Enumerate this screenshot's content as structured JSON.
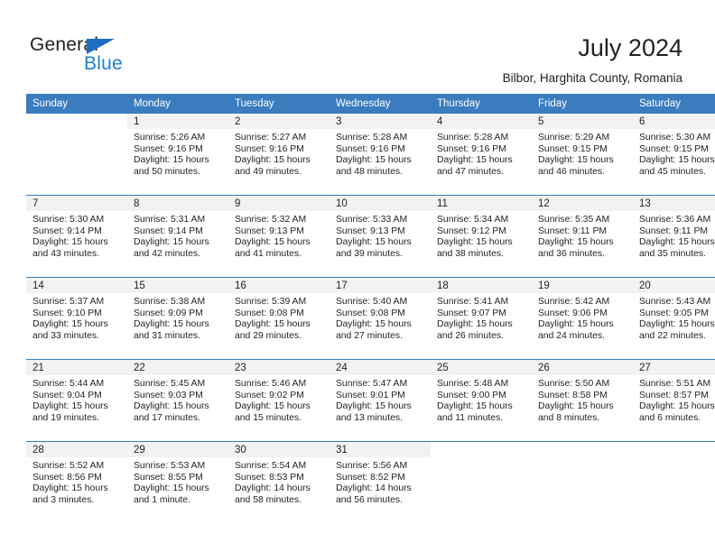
{
  "brand": {
    "name_part1": "General",
    "name_part2": "Blue"
  },
  "header": {
    "title": "July 2024",
    "location": "Bilbor, Harghita County, Romania"
  },
  "colors": {
    "header_blue": "#3a7cbe",
    "brand_blue": "#1b7fd4",
    "daynum_band": "#f2f2f2",
    "text": "#231f20"
  },
  "weekday_headers": [
    "Sunday",
    "Monday",
    "Tuesday",
    "Wednesday",
    "Thursday",
    "Friday",
    "Saturday"
  ],
  "weeks": [
    [
      {
        "day": "",
        "sunrise": "",
        "sunset": "",
        "daylight_line1": "",
        "daylight_line2": "",
        "blank": true
      },
      {
        "day": "1",
        "sunrise": "Sunrise: 5:26 AM",
        "sunset": "Sunset: 9:16 PM",
        "daylight_line1": "Daylight: 15 hours",
        "daylight_line2": "and 50 minutes."
      },
      {
        "day": "2",
        "sunrise": "Sunrise: 5:27 AM",
        "sunset": "Sunset: 9:16 PM",
        "daylight_line1": "Daylight: 15 hours",
        "daylight_line2": "and 49 minutes."
      },
      {
        "day": "3",
        "sunrise": "Sunrise: 5:28 AM",
        "sunset": "Sunset: 9:16 PM",
        "daylight_line1": "Daylight: 15 hours",
        "daylight_line2": "and 48 minutes."
      },
      {
        "day": "4",
        "sunrise": "Sunrise: 5:28 AM",
        "sunset": "Sunset: 9:16 PM",
        "daylight_line1": "Daylight: 15 hours",
        "daylight_line2": "and 47 minutes."
      },
      {
        "day": "5",
        "sunrise": "Sunrise: 5:29 AM",
        "sunset": "Sunset: 9:15 PM",
        "daylight_line1": "Daylight: 15 hours",
        "daylight_line2": "and 46 minutes."
      },
      {
        "day": "6",
        "sunrise": "Sunrise: 5:30 AM",
        "sunset": "Sunset: 9:15 PM",
        "daylight_line1": "Daylight: 15 hours",
        "daylight_line2": "and 45 minutes."
      }
    ],
    [
      {
        "day": "7",
        "sunrise": "Sunrise: 5:30 AM",
        "sunset": "Sunset: 9:14 PM",
        "daylight_line1": "Daylight: 15 hours",
        "daylight_line2": "and 43 minutes."
      },
      {
        "day": "8",
        "sunrise": "Sunrise: 5:31 AM",
        "sunset": "Sunset: 9:14 PM",
        "daylight_line1": "Daylight: 15 hours",
        "daylight_line2": "and 42 minutes."
      },
      {
        "day": "9",
        "sunrise": "Sunrise: 5:32 AM",
        "sunset": "Sunset: 9:13 PM",
        "daylight_line1": "Daylight: 15 hours",
        "daylight_line2": "and 41 minutes."
      },
      {
        "day": "10",
        "sunrise": "Sunrise: 5:33 AM",
        "sunset": "Sunset: 9:13 PM",
        "daylight_line1": "Daylight: 15 hours",
        "daylight_line2": "and 39 minutes."
      },
      {
        "day": "11",
        "sunrise": "Sunrise: 5:34 AM",
        "sunset": "Sunset: 9:12 PM",
        "daylight_line1": "Daylight: 15 hours",
        "daylight_line2": "and 38 minutes."
      },
      {
        "day": "12",
        "sunrise": "Sunrise: 5:35 AM",
        "sunset": "Sunset: 9:11 PM",
        "daylight_line1": "Daylight: 15 hours",
        "daylight_line2": "and 36 minutes."
      },
      {
        "day": "13",
        "sunrise": "Sunrise: 5:36 AM",
        "sunset": "Sunset: 9:11 PM",
        "daylight_line1": "Daylight: 15 hours",
        "daylight_line2": "and 35 minutes."
      }
    ],
    [
      {
        "day": "14",
        "sunrise": "Sunrise: 5:37 AM",
        "sunset": "Sunset: 9:10 PM",
        "daylight_line1": "Daylight: 15 hours",
        "daylight_line2": "and 33 minutes."
      },
      {
        "day": "15",
        "sunrise": "Sunrise: 5:38 AM",
        "sunset": "Sunset: 9:09 PM",
        "daylight_line1": "Daylight: 15 hours",
        "daylight_line2": "and 31 minutes."
      },
      {
        "day": "16",
        "sunrise": "Sunrise: 5:39 AM",
        "sunset": "Sunset: 9:08 PM",
        "daylight_line1": "Daylight: 15 hours",
        "daylight_line2": "and 29 minutes."
      },
      {
        "day": "17",
        "sunrise": "Sunrise: 5:40 AM",
        "sunset": "Sunset: 9:08 PM",
        "daylight_line1": "Daylight: 15 hours",
        "daylight_line2": "and 27 minutes."
      },
      {
        "day": "18",
        "sunrise": "Sunrise: 5:41 AM",
        "sunset": "Sunset: 9:07 PM",
        "daylight_line1": "Daylight: 15 hours",
        "daylight_line2": "and 26 minutes."
      },
      {
        "day": "19",
        "sunrise": "Sunrise: 5:42 AM",
        "sunset": "Sunset: 9:06 PM",
        "daylight_line1": "Daylight: 15 hours",
        "daylight_line2": "and 24 minutes."
      },
      {
        "day": "20",
        "sunrise": "Sunrise: 5:43 AM",
        "sunset": "Sunset: 9:05 PM",
        "daylight_line1": "Daylight: 15 hours",
        "daylight_line2": "and 22 minutes."
      }
    ],
    [
      {
        "day": "21",
        "sunrise": "Sunrise: 5:44 AM",
        "sunset": "Sunset: 9:04 PM",
        "daylight_line1": "Daylight: 15 hours",
        "daylight_line2": "and 19 minutes."
      },
      {
        "day": "22",
        "sunrise": "Sunrise: 5:45 AM",
        "sunset": "Sunset: 9:03 PM",
        "daylight_line1": "Daylight: 15 hours",
        "daylight_line2": "and 17 minutes."
      },
      {
        "day": "23",
        "sunrise": "Sunrise: 5:46 AM",
        "sunset": "Sunset: 9:02 PM",
        "daylight_line1": "Daylight: 15 hours",
        "daylight_line2": "and 15 minutes."
      },
      {
        "day": "24",
        "sunrise": "Sunrise: 5:47 AM",
        "sunset": "Sunset: 9:01 PM",
        "daylight_line1": "Daylight: 15 hours",
        "daylight_line2": "and 13 minutes."
      },
      {
        "day": "25",
        "sunrise": "Sunrise: 5:48 AM",
        "sunset": "Sunset: 9:00 PM",
        "daylight_line1": "Daylight: 15 hours",
        "daylight_line2": "and 11 minutes."
      },
      {
        "day": "26",
        "sunrise": "Sunrise: 5:50 AM",
        "sunset": "Sunset: 8:58 PM",
        "daylight_line1": "Daylight: 15 hours",
        "daylight_line2": "and 8 minutes."
      },
      {
        "day": "27",
        "sunrise": "Sunrise: 5:51 AM",
        "sunset": "Sunset: 8:57 PM",
        "daylight_line1": "Daylight: 15 hours",
        "daylight_line2": "and 6 minutes."
      }
    ],
    [
      {
        "day": "28",
        "sunrise": "Sunrise: 5:52 AM",
        "sunset": "Sunset: 8:56 PM",
        "daylight_line1": "Daylight: 15 hours",
        "daylight_line2": "and 3 minutes."
      },
      {
        "day": "29",
        "sunrise": "Sunrise: 5:53 AM",
        "sunset": "Sunset: 8:55 PM",
        "daylight_line1": "Daylight: 15 hours",
        "daylight_line2": "and 1 minute."
      },
      {
        "day": "30",
        "sunrise": "Sunrise: 5:54 AM",
        "sunset": "Sunset: 8:53 PM",
        "daylight_line1": "Daylight: 14 hours",
        "daylight_line2": "and 58 minutes."
      },
      {
        "day": "31",
        "sunrise": "Sunrise: 5:56 AM",
        "sunset": "Sunset: 8:52 PM",
        "daylight_line1": "Daylight: 14 hours",
        "daylight_line2": "and 56 minutes."
      },
      {
        "day": "",
        "sunrise": "",
        "sunset": "",
        "daylight_line1": "",
        "daylight_line2": "",
        "blank": true
      },
      {
        "day": "",
        "sunrise": "",
        "sunset": "",
        "daylight_line1": "",
        "daylight_line2": "",
        "blank": true
      },
      {
        "day": "",
        "sunrise": "",
        "sunset": "",
        "daylight_line1": "",
        "daylight_line2": "",
        "blank": true
      }
    ]
  ]
}
